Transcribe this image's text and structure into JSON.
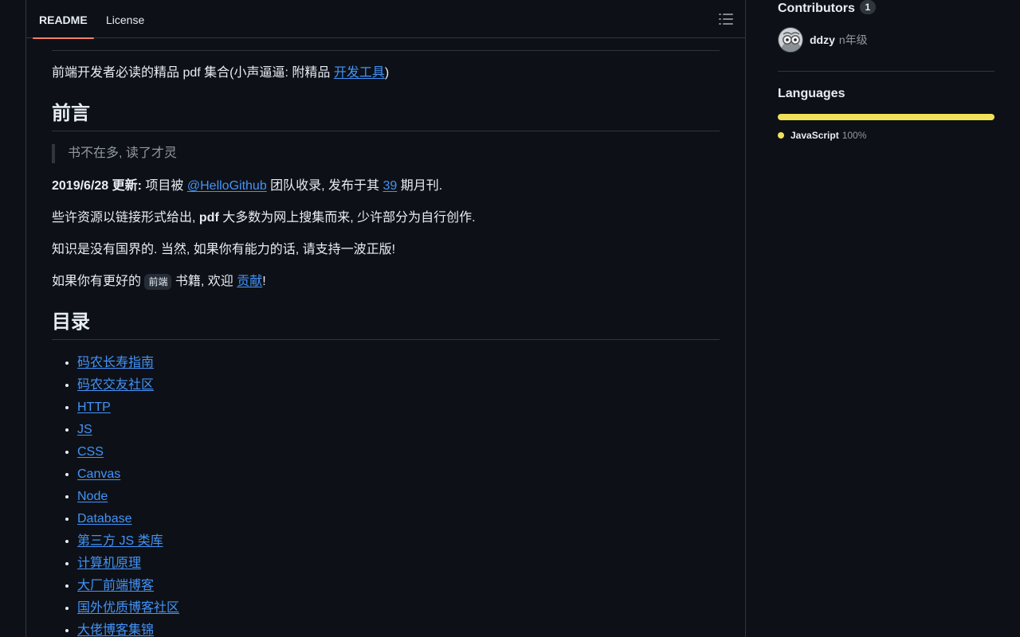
{
  "readme": {
    "tabs": [
      {
        "label": "README",
        "active": true
      },
      {
        "label": "License",
        "active": false
      }
    ],
    "toc_icon": "list-unordered-icon",
    "intro": {
      "text": "前端开发者必读的精品 pdf 集合(小声逼逼: 附精品 ",
      "link": "开发工具",
      "after": ")"
    },
    "section_preface": {
      "heading": "前言",
      "quote": "书不在多, 读了才灵",
      "update": {
        "bold": "2019/6/28 更新:",
        "t1": " 项目被 ",
        "link1": "@HelloGithub",
        "t2": " 团队收录, 发布于其 ",
        "link2": "39",
        "t3": " 期月刊."
      },
      "p2": {
        "t1": "些许资源以链接形式给出, ",
        "bold": "pdf",
        "t2": " 大多数为网上搜集而来, 少许部分为自行创作."
      },
      "p3": "知识是没有国界的. 当然, 如果你有能力的话, 请支持一波正版!",
      "p4": {
        "t1": "如果你有更好的 ",
        "code": "前端",
        "t2": " 书籍, 欢迎 ",
        "link": "贡献",
        "t3": "!"
      }
    },
    "section_toc": {
      "heading": "目录",
      "items": [
        "码农长寿指南",
        "码农交友社区",
        "HTTP",
        "JS",
        "CSS",
        "Canvas",
        "Node",
        "Database",
        "第三方 JS 类库",
        "计算机原理",
        "大厂前端博客",
        "国外优质博客社区",
        "大佬博客集锦"
      ]
    }
  },
  "sidebar": {
    "contributors": {
      "title": "Contributors",
      "count": "1",
      "people": [
        {
          "login": "ddzy",
          "name": "n年级",
          "avatar_icon": "owl-avatar-icon"
        }
      ]
    },
    "languages": {
      "title": "Languages",
      "items": [
        {
          "name": "JavaScript",
          "percent": "100%",
          "fraction": 1.0,
          "color": "#f1e05a"
        }
      ]
    }
  },
  "colors": {
    "background": "#0d1117",
    "text": "#e6edf3",
    "link": "#4493f8",
    "border": "#30363d",
    "active_tab_underline": "#f78166"
  }
}
